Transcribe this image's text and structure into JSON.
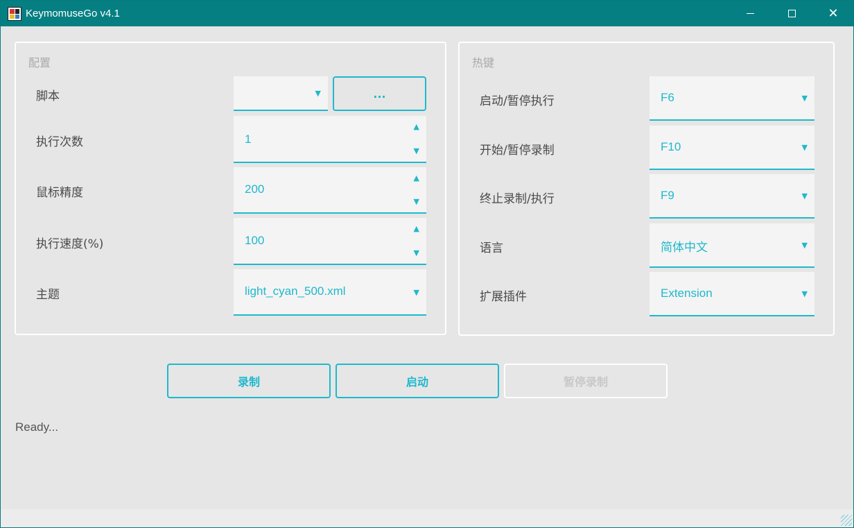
{
  "window": {
    "title": "KeymomuseGo v4.1"
  },
  "config": {
    "title": "配置",
    "script_label": "脚本",
    "script_value": "",
    "browse_label": "...",
    "run_count_label": "执行次数",
    "run_count_value": "1",
    "mouse_precision_label": "鼠标精度",
    "mouse_precision_value": "200",
    "speed_label": "执行速度(%)",
    "speed_value": "100",
    "theme_label": "主题",
    "theme_value": "light_cyan_500.xml"
  },
  "hotkeys": {
    "title": "热键",
    "start_pause_exec_label": "启动/暂停执行",
    "start_pause_exec_value": "F6",
    "start_pause_record_label": "开始/暂停录制",
    "start_pause_record_value": "F10",
    "stop_label": "终止录制/执行",
    "stop_value": "F9",
    "language_label": "语言",
    "language_value": "简体中文",
    "extension_label": "扩展插件",
    "extension_value": "Extension"
  },
  "actions": {
    "record": "录制",
    "start": "启动",
    "pause_record": "暂停录制"
  },
  "status": "Ready...",
  "icons": {
    "dropdown": "▼",
    "spin_up": "▲",
    "spin_down": "▼",
    "close": "✕"
  },
  "colors": {
    "titlebar": "#067f82",
    "accent": "#1fb8cc",
    "background": "#e6e6e6"
  }
}
